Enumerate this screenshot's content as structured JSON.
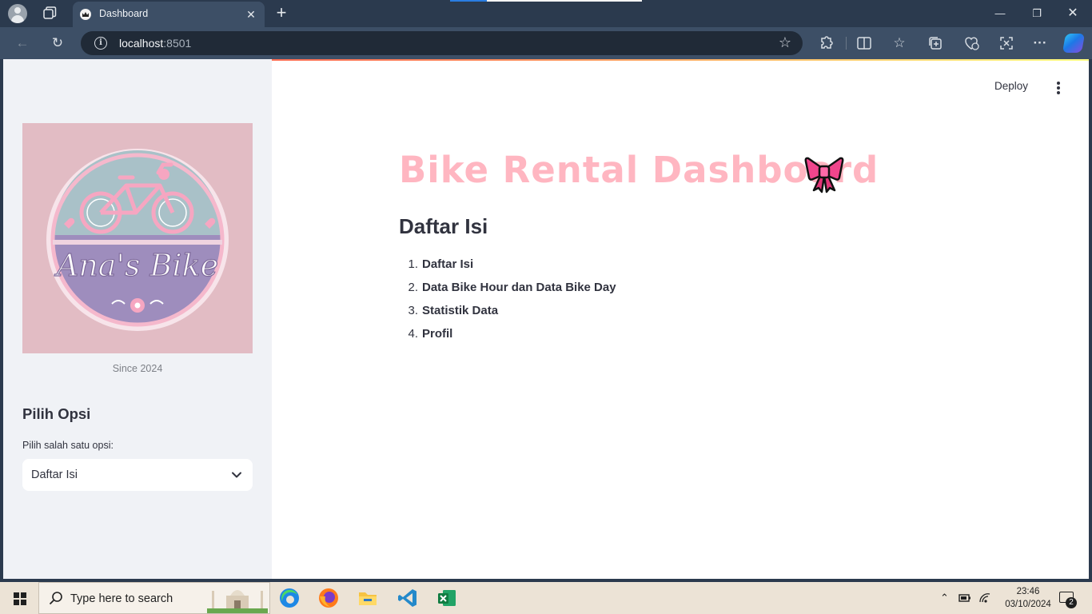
{
  "browser": {
    "tab_title": "Dashboard",
    "address_host": "localhost",
    "address_port": ":8501"
  },
  "icons": {
    "tabbar": [
      "profile-avatar-icon",
      "workspaces-icon",
      "streamlit-crown-favicon",
      "close-icon",
      "plus-icon",
      "minimize-icon",
      "restore-icon",
      "close-window-icon"
    ],
    "navbar": [
      "back-arrow-icon",
      "refresh-icon",
      "info-icon",
      "star-icon",
      "extensions-icon",
      "split-screen-icon",
      "favorites-icon",
      "collections-icon",
      "browser-essentials-icon",
      "screenshot-icon",
      "more-icon",
      "copilot-icon"
    ]
  },
  "sidebar": {
    "logo_text": "Ana's Bike",
    "logo_caption": "Since 2024",
    "heading": "Pilih Opsi",
    "select_label": "Pilih salah satu opsi:",
    "select_value": "Daftar Isi"
  },
  "header": {
    "deploy_label": "Deploy"
  },
  "main": {
    "title": "Bike Rental Dashboard",
    "title_emoji": "ribbon-bow-emoji",
    "section_heading": "Daftar Isi",
    "toc": [
      {
        "num": "1.",
        "label": "Daftar Isi"
      },
      {
        "num": "2.",
        "label": "Data Bike Hour dan Data Bike Day"
      },
      {
        "num": "3.",
        "label": "Statistik Data"
      },
      {
        "num": "4.",
        "label": "Profil"
      }
    ]
  },
  "taskbar": {
    "search_placeholder": "Type here to search",
    "apps": [
      "edge-icon",
      "firefox-icon",
      "file-explorer-icon",
      "vscode-icon",
      "excel-icon"
    ],
    "time": "23:46",
    "date": "03/10/2024",
    "notification_count": "2"
  },
  "colors": {
    "title_pink": "#ffb6c1",
    "sidebar_bg": "#f0f2f6",
    "text": "#31333f",
    "browser_frame": "#2b3a4e"
  }
}
